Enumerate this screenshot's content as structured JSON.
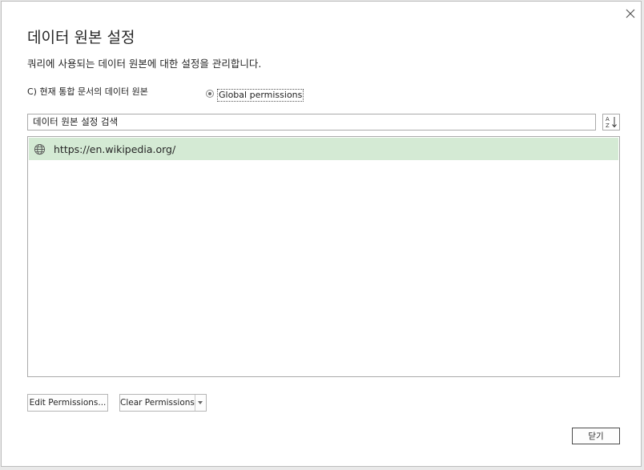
{
  "dialog": {
    "title": "데이터 원본 설정",
    "subtitle": "쿼리에 사용되는 데이터 원본에 대한 설정을 관리합니다.",
    "scope": {
      "current_label": "C) 현재 통합 문서의 데이터 원본",
      "global_label": "Global permissions",
      "selected": "global"
    },
    "search": {
      "value": "데이터 원본 설정 검색"
    },
    "sources": [
      {
        "icon": "globe-icon",
        "url": "https://en.wikipedia.org/",
        "selected": true
      }
    ],
    "buttons": {
      "edit": "Edit Permissions...",
      "clear": "Clear Permissions",
      "close": "닫기"
    },
    "colors": {
      "selected_row": "#d4ead4"
    }
  }
}
